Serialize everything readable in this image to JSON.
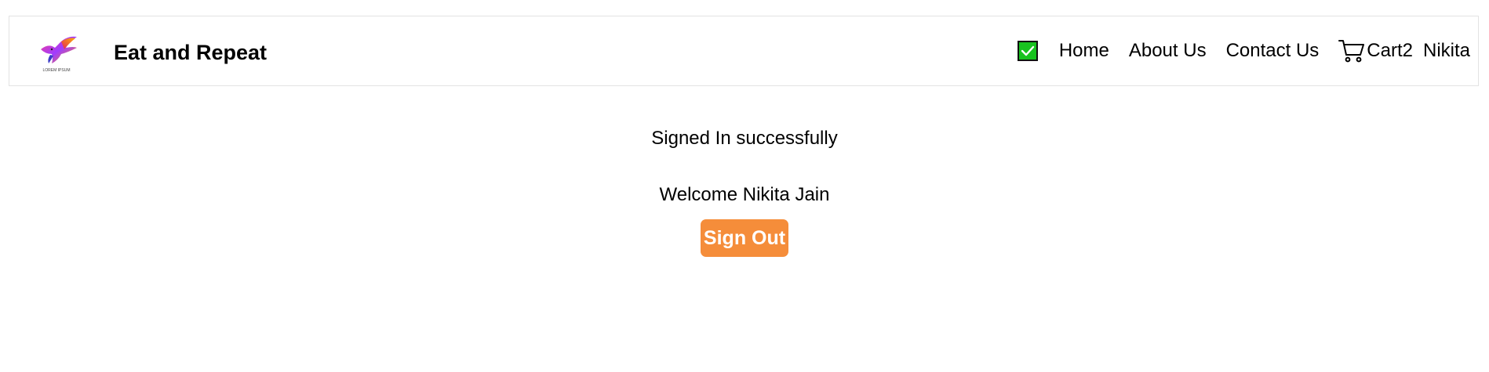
{
  "header": {
    "brand": "Eat and Repeat",
    "logo_icon": "bird-logo-icon",
    "logo_text": "LOREM IPSUM",
    "toggle_checked": true,
    "toggle_color": "#18c31f",
    "nav": {
      "home": "Home",
      "about": "About Us",
      "contact": "Contact Us",
      "cart_label": "Cart",
      "cart_count": "2",
      "cart_icon": "shopping-cart-icon",
      "user": "Nikita"
    }
  },
  "main": {
    "status_message": "Signed In successfully",
    "welcome_message": "Welcome Nikita Jain",
    "sign_out_label": "Sign Out",
    "button_color": "#f58d3a"
  }
}
